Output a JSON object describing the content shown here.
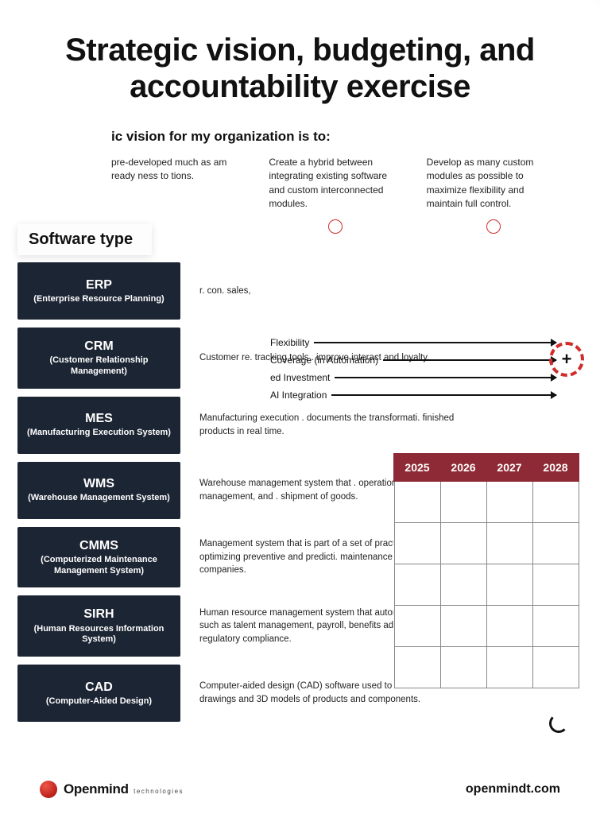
{
  "title": "Strategic vision, budgeting, and accountability exercise",
  "subtitle": "ic vision for my organization is to:",
  "options": [
    "pre-developed much as am ready ness to tions.",
    "Create a hybrid between integrating existing software and custom interconnected modules.",
    "Develop as many custom modules as possible to maximize flexibility and maintain full control."
  ],
  "software_label": "Software type",
  "software": [
    {
      "abbr": "ERP",
      "full": "(Enterprise Resource Planning)",
      "desc": "r. con. sales,"
    },
    {
      "abbr": "CRM",
      "full": "(Customer Relationship Management)",
      "desc": "Customer re. tracking tools . improve interact and loyalty."
    },
    {
      "abbr": "MES",
      "full": "(Manufacturing Execution System)",
      "desc": "Manufacturing execution . documents the transformati. finished products in real time."
    },
    {
      "abbr": "WMS",
      "full": "(Warehouse Management System)",
      "desc": "Warehouse management system that . operations, inventory management, and . shipment of goods."
    },
    {
      "abbr": "CMMS",
      "full": "(Computerized Maintenance Management System)",
      "desc": "Management system that is part of a set of practic. software aimed at optimizing preventive and predicti. maintenance management within companies."
    },
    {
      "abbr": "SIRH",
      "full": "(Human Resources Information System)",
      "desc": "Human resource management system that automates HR processes such as talent management, payroll, benefits administration, and regulatory compliance."
    },
    {
      "abbr": "CAD",
      "full": "(Computer-Aided Design)",
      "desc": "Computer-aided design (CAD) software used to create technical drawings and 3D models of products and components."
    }
  ],
  "arrows": [
    "Flexibility",
    "Coverage (in Automation)",
    "ed Investment",
    "AI Integration"
  ],
  "plus": "+",
  "years": [
    "2025",
    "2026",
    "2027",
    "2028"
  ],
  "logo": {
    "name": "Openmind",
    "sub": "technologies"
  },
  "site": "openmindt.com"
}
